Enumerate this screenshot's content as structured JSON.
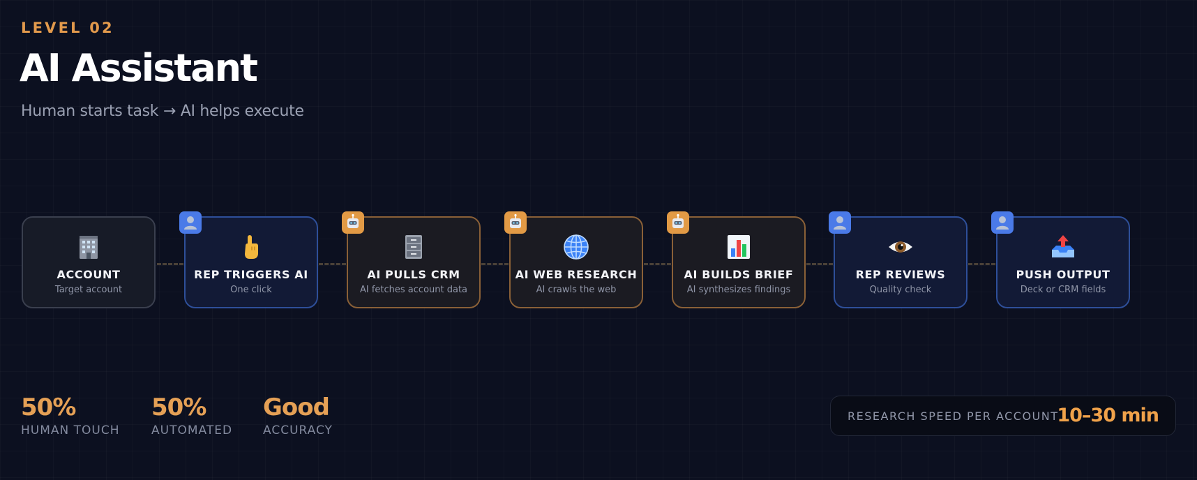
{
  "header": {
    "level": "LEVEL 02",
    "title": "AI Assistant",
    "subtitle": "Human starts task → AI helps execute"
  },
  "colors": {
    "accent": "#e5a055",
    "human": "#4a7ae8",
    "ai": "#e29a45",
    "background": "#0c1020"
  },
  "flow": {
    "steps": [
      {
        "label": "ACCOUNT",
        "description": "Target account",
        "icon": "office-building-icon",
        "actor": "neutral"
      },
      {
        "label": "REP TRIGGERS AI",
        "description": "One click",
        "icon": "pointing-hand-icon",
        "actor": "human"
      },
      {
        "label": "AI PULLS CRM",
        "description": "AI fetches account data",
        "icon": "file-cabinet-icon",
        "actor": "ai"
      },
      {
        "label": "AI WEB RESEARCH",
        "description": "AI crawls the web",
        "icon": "globe-icon",
        "actor": "ai"
      },
      {
        "label": "AI BUILDS BRIEF",
        "description": "AI synthesizes findings",
        "icon": "bar-chart-icon",
        "actor": "ai"
      },
      {
        "label": "REP REVIEWS",
        "description": "Quality check",
        "icon": "eye-icon",
        "actor": "human"
      },
      {
        "label": "PUSH OUTPUT",
        "description": "Deck or CRM fields",
        "icon": "outbox-tray-icon",
        "actor": "human"
      }
    ]
  },
  "stats": [
    {
      "value": "50%",
      "label": "HUMAN TOUCH"
    },
    {
      "value": "50%",
      "label": "AUTOMATED"
    },
    {
      "value": "Good",
      "label": "ACCURACY"
    }
  ],
  "speed": {
    "label": "RESEARCH SPEED PER ACCOUNT",
    "value": "10–30 min"
  }
}
